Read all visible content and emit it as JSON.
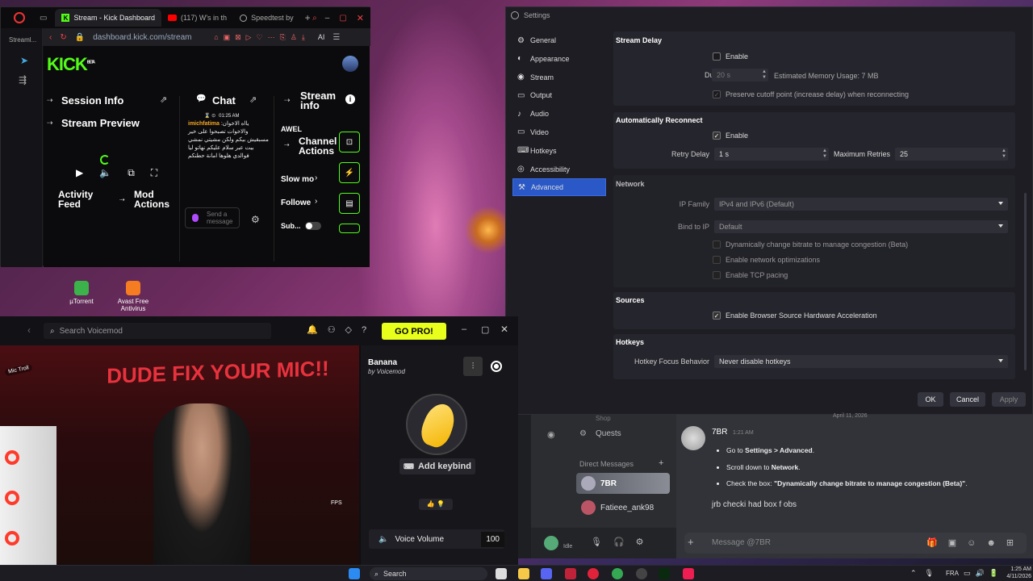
{
  "desktop": {
    "icons": [
      {
        "label": "µTorrent",
        "color": "#3bb34a"
      },
      {
        "label": "Avast Free Antivirus",
        "color": "#f57c20"
      }
    ]
  },
  "browser": {
    "tabs": [
      {
        "label": "Stream - Kick Dashboard",
        "icon": "kick-icon"
      },
      {
        "label": "(117) W's in th",
        "icon": "youtube-icon"
      },
      {
        "label": "Speedtest by",
        "icon": "speedtest-icon"
      }
    ],
    "url": "dashboard.kick.com/stream",
    "sidebar_label": "Streaml...",
    "ai_label": "AI",
    "kick": {
      "logo": "KICK",
      "logo_beta": "BETA",
      "session_info": "Session Info",
      "stream_preview": "Stream Preview",
      "chat_title": "Chat",
      "stream_info_title": "Stream info",
      "activity_feed": "Activity Feed",
      "mod_actions": "Mod Actions",
      "channel_name": "AWEL",
      "channel_actions": "Channel Actions",
      "slow_mode": "Slow mo",
      "followers": "Followe",
      "subscribers": "Sub...",
      "chat_message": {
        "time": "01:25 AM",
        "user": "imichfatima",
        "text": "يااه الاخوان: والاخوات تصبحوا على خير مسبقيش بيكم ولكن مشيتي نمشي بيت عبر سلام عليكم نهاتو ليا فوالدي هلوها امانة حطنكم"
      },
      "send_placeholder": "Send a message"
    }
  },
  "settings": {
    "title": "Settings",
    "nav": [
      {
        "label": "General",
        "icon": "gear-icon"
      },
      {
        "label": "Appearance",
        "icon": "appearance-icon"
      },
      {
        "label": "Stream",
        "icon": "stream-icon"
      },
      {
        "label": "Output",
        "icon": "output-icon"
      },
      {
        "label": "Audio",
        "icon": "audio-icon"
      },
      {
        "label": "Video",
        "icon": "video-icon"
      },
      {
        "label": "Hotkeys",
        "icon": "keyboard-icon"
      },
      {
        "label": "Accessibility",
        "icon": "accessibility-icon"
      },
      {
        "label": "Advanced",
        "icon": "advanced-icon",
        "active": true
      }
    ],
    "stream_delay": {
      "title": "Stream Delay",
      "enable_label": "Enable",
      "enabled": false,
      "duration_label": "Duration",
      "duration_value": "20 s",
      "memory_label": "Estimated Memory Usage: 7 MB",
      "preserve_label": "Preserve cutoff point (increase delay) when reconnecting"
    },
    "auto_reconnect": {
      "title": "Automatically Reconnect",
      "enable_label": "Enable",
      "enabled": true,
      "retry_delay_label": "Retry Delay",
      "retry_delay_value": "1 s",
      "max_retries_label": "Maximum Retries",
      "max_retries_value": "25"
    },
    "network": {
      "title": "Network",
      "ip_family_label": "IP Family",
      "ip_family_value": "IPv4 and IPv6 (Default)",
      "bind_label": "Bind to IP",
      "bind_value": "Default",
      "dynamic_bitrate_label": "Dynamically change bitrate to manage congestion (Beta)",
      "net_opt_label": "Enable network optimizations",
      "tcp_pacing_label": "Enable TCP pacing"
    },
    "sources": {
      "title": "Sources",
      "hw_accel_label": "Enable Browser Source Hardware Acceleration",
      "hw_accel": true
    },
    "hotkeys": {
      "title": "Hotkeys",
      "focus_label": "Hotkey Focus Behavior",
      "focus_value": "Never disable hotkeys"
    },
    "buttons": {
      "ok": "OK",
      "cancel": "Cancel",
      "apply": "Apply"
    }
  },
  "voicemod": {
    "search_placeholder": "Search Voicemod",
    "go_pro": "GO PRO!",
    "cam_text": "DUDE FIX YOUR MIC!!",
    "cam_badge": "Mic Troll",
    "fps_label": "FPS",
    "voice_name": "Banana",
    "voice_by": "by Voicemod",
    "add_keybind": "Add keybind",
    "voice_volume_label": "Voice Volume",
    "voice_volume_value": "100"
  },
  "discord": {
    "shop_label": "Shop",
    "quests_label": "Quests",
    "dm_header": "Direct Messages",
    "dms": [
      {
        "name": "7BR",
        "active": true
      },
      {
        "name": "Fatieee_ank98",
        "active": false
      }
    ],
    "user_status": "Idle",
    "date_label": "April 11, 2026",
    "message_author": "7BR",
    "message_time": "1:21 AM",
    "steps": [
      {
        "pre": "Go to ",
        "bold": "Settings > Advanced",
        "post": "."
      },
      {
        "pre": "Scroll down to ",
        "bold": "Network",
        "post": "."
      },
      {
        "pre": "Check the box: ",
        "bold": "\"Dynamically change bitrate to manage congestion (Beta)\"",
        "post": "."
      }
    ],
    "reply": "jrb checki had box f obs",
    "input_placeholder": "Message @7BR"
  },
  "taskbar": {
    "search_label": "Search",
    "lang": "FRA",
    "time": "1:25 AM",
    "date": "4/11/2026"
  }
}
